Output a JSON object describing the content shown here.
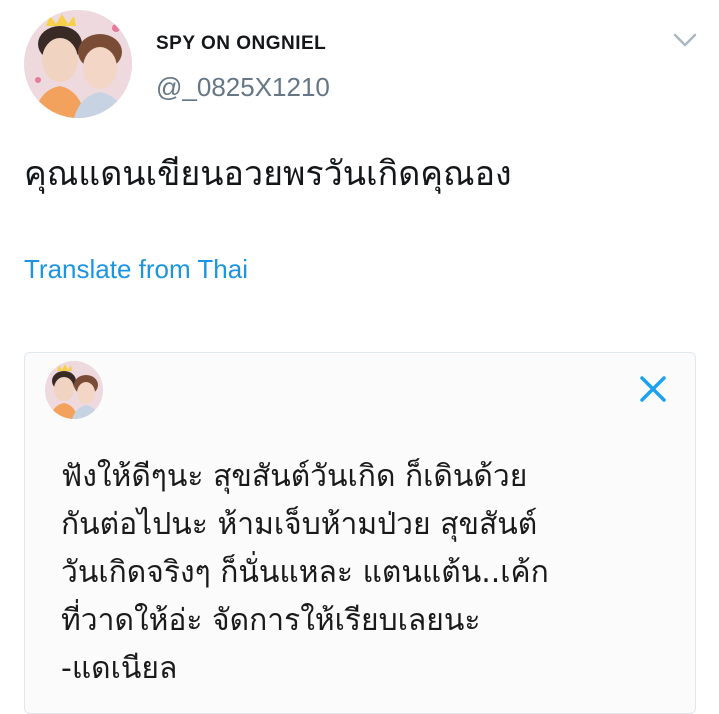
{
  "tweet": {
    "display_name": "SPY ON ONGNIEL",
    "handle": "@_0825X1210",
    "text": "คุณแดนเขียนอวยพรวันเกิดคุณอง",
    "translate_label": "Translate from Thai",
    "menu_icon": "chevron-down-icon"
  },
  "embedded_note": {
    "close_icon": "close-icon",
    "lines": [
      "ฟังให้ดีๆนะ สุขสันต์วันเกิด ก็เดินด้วย",
      "กันต่อไปนะ ห้ามเจ็บห้ามป่วย สุขสันต์",
      "วันเกิดจริงๆ ก็นั่นแหละ แตนแต้น..เค้ก",
      "ที่วาดให้อ่ะ จัดการให้เรียบเลยนะ",
      "-แดเนียล"
    ]
  },
  "colors": {
    "link": "#1b95e0",
    "handle": "#657786",
    "close_icon": "#1da1f2",
    "caret": "#aab8c2"
  }
}
